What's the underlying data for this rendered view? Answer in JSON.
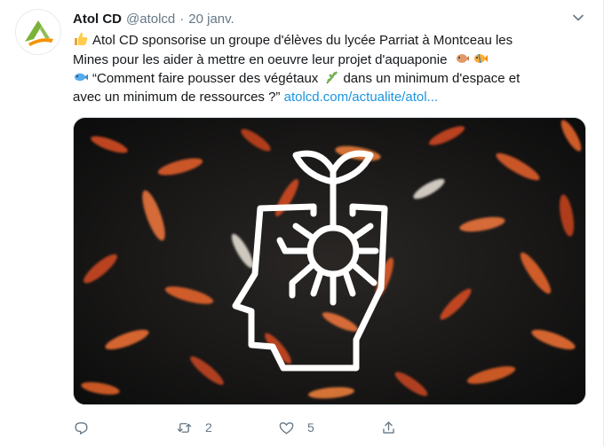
{
  "tweet": {
    "author_name": "Atol CD",
    "author_handle": "@atolcd",
    "separator": "·",
    "date": "20 janv.",
    "text_line1": "Atol CD sponsorise un groupe d'élèves du lycée Parriat à Montceau les",
    "text_line2": "Mines pour les aider à mettre en oeuvre leur projet d'aquaponie",
    "text_line3a": "“Comment faire pousser des végétaux",
    "text_line3b": "dans un minimum d'espace et",
    "text_line4": "avec un minimum de ressources ?”",
    "link_text": "atolcd.com/actualite/atol..."
  },
  "actions": {
    "reply_count": "",
    "retweet_count": "2",
    "like_count": "5"
  },
  "icons": {
    "avatar": "atol-logo-icon",
    "caret": "chevron-down-icon",
    "emoji_thumbs": "thumbs-up-icon",
    "emoji_fish1": "blowfish-icon",
    "emoji_fish2": "tropical-fish-icon",
    "emoji_fish3": "fish-icon",
    "emoji_herb": "herb-icon",
    "reply": "reply-icon",
    "retweet": "retweet-icon",
    "like": "heart-icon",
    "share": "share-icon"
  },
  "colors": {
    "link": "#1b95e0",
    "muted": "#657786",
    "logo_green": "#7bb33a",
    "logo_orange": "#f39200"
  }
}
